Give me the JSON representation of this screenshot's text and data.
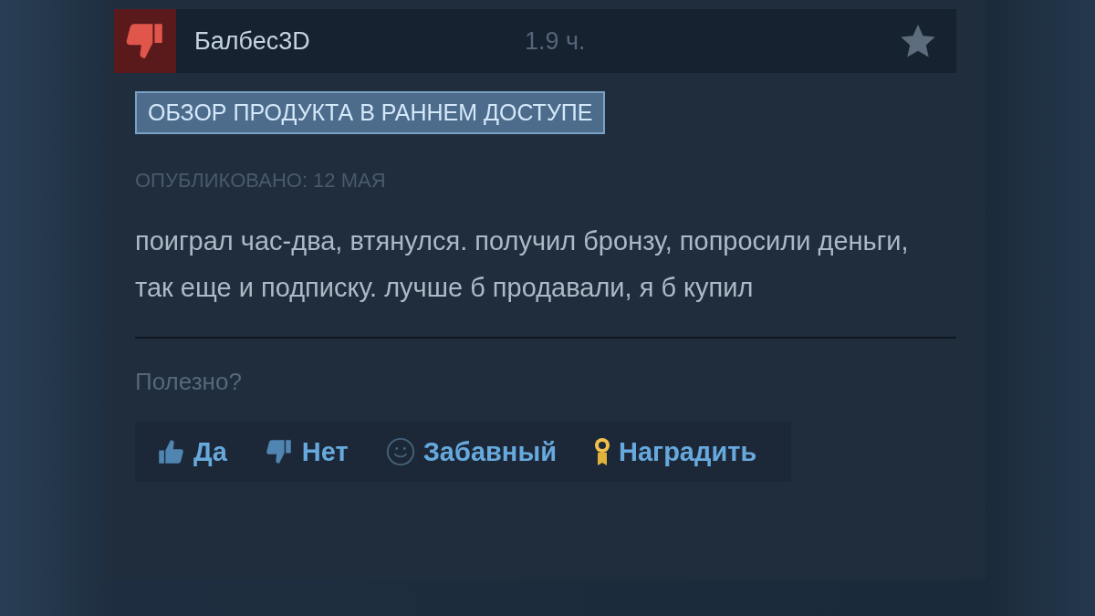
{
  "review": {
    "recommended": false,
    "author": "Балбес3D",
    "hours": "1.9 ч.",
    "badge": "ОБЗОР ПРОДУКТА В РАННЕМ ДОСТУПЕ",
    "posted": "ОПУБЛИКОВАНО: 12 МАЯ",
    "text": "поиграл час-два, втянулся. получил бронзу, попросили деньги, так еще и подписку. лучше б продавали, я б купил",
    "helpful_prompt": "Полезно?",
    "actions": [
      {
        "kind": "yes",
        "label": "Да"
      },
      {
        "kind": "no",
        "label": "Нет"
      },
      {
        "kind": "funny",
        "label": "Забавный"
      },
      {
        "kind": "award",
        "label": "Наградить"
      }
    ]
  }
}
